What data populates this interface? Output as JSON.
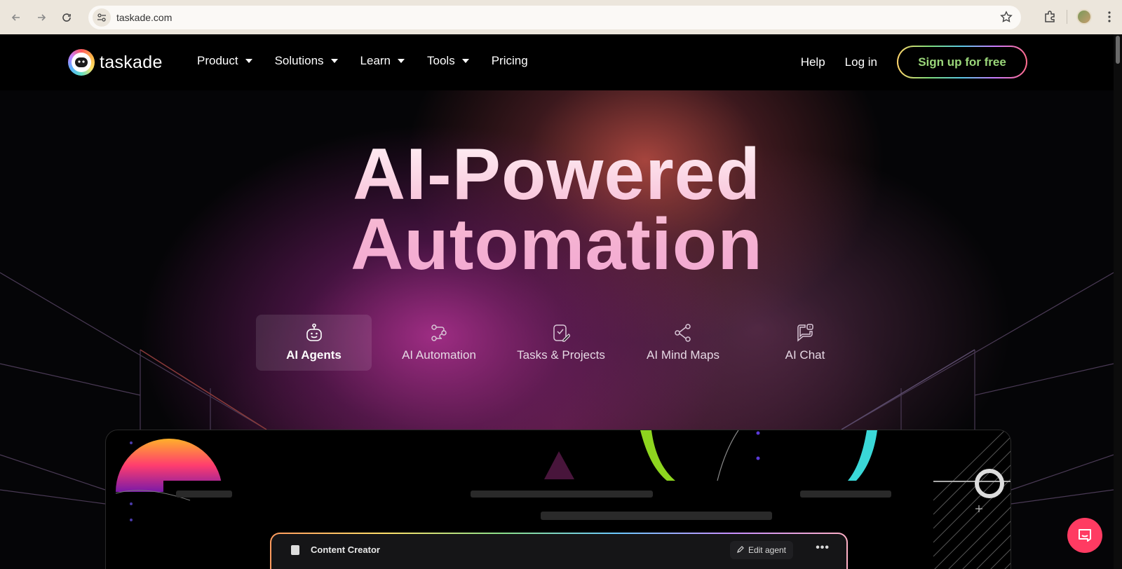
{
  "browser": {
    "url": "taskade.com"
  },
  "nav": {
    "logo_text": "taskade",
    "items": [
      {
        "label": "Product",
        "dropdown": true
      },
      {
        "label": "Solutions",
        "dropdown": true
      },
      {
        "label": "Learn",
        "dropdown": true
      },
      {
        "label": "Tools",
        "dropdown": true
      },
      {
        "label": "Pricing",
        "dropdown": false
      }
    ],
    "help": "Help",
    "login": "Log in",
    "signup": "Sign up for free"
  },
  "hero": {
    "line1": "AI-Powered",
    "line2": "Automation"
  },
  "tabs": [
    {
      "label": "AI Agents",
      "icon": "robot-icon",
      "active": true
    },
    {
      "label": "AI Automation",
      "icon": "automation-icon",
      "active": false
    },
    {
      "label": "Tasks & Projects",
      "icon": "tasks-icon",
      "active": false
    },
    {
      "label": "AI Mind Maps",
      "icon": "mind-map-icon",
      "active": false
    },
    {
      "label": "AI Chat",
      "icon": "chat-icon",
      "active": false
    }
  ],
  "demo": {
    "card_title": "Content Creator",
    "edit_label": "Edit agent",
    "more_label": "•••"
  },
  "colors": {
    "signup_text": "#9bd77a",
    "intercom": "#ff3b62"
  }
}
